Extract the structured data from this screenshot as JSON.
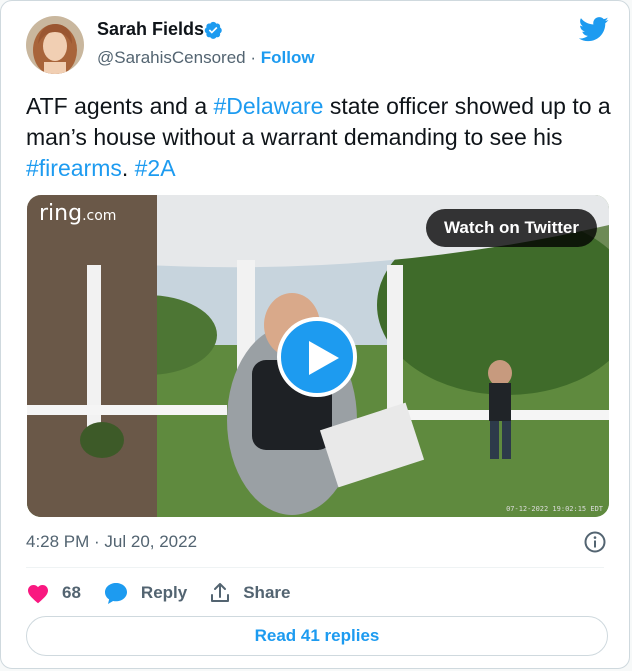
{
  "author": {
    "name": "Sarah Fields",
    "handle": "@SarahisCensored",
    "separator": "·",
    "follow_label": "Follow"
  },
  "tweet": {
    "parts": {
      "t1": "ATF agents and a ",
      "tag1": "#Delaware",
      "t2": " state officer showed up to a man’s house without a warrant demanding to see his ",
      "tag2": "#firearms",
      "t3": ". ",
      "tag3": "#2A"
    }
  },
  "media": {
    "brand": "ring",
    "brand_suffix": ".com",
    "watch_label": "Watch on Twitter",
    "timestamp_overlay": "07-12-2022 19:02:15 EDT"
  },
  "meta": {
    "time": "4:28 PM · Jul 20, 2022"
  },
  "actions": {
    "likes": "68",
    "reply_label": "Reply",
    "share_label": "Share",
    "read_replies_label": "Read 41 replies"
  },
  "colors": {
    "accent": "#1d9bf0",
    "like": "#f91880",
    "text": "#0f1419",
    "muted": "#536471"
  },
  "icons": [
    "verified-badge-icon",
    "twitter-bird-icon",
    "play-icon",
    "info-icon",
    "heart-icon",
    "reply-bubble-icon",
    "share-icon"
  ]
}
